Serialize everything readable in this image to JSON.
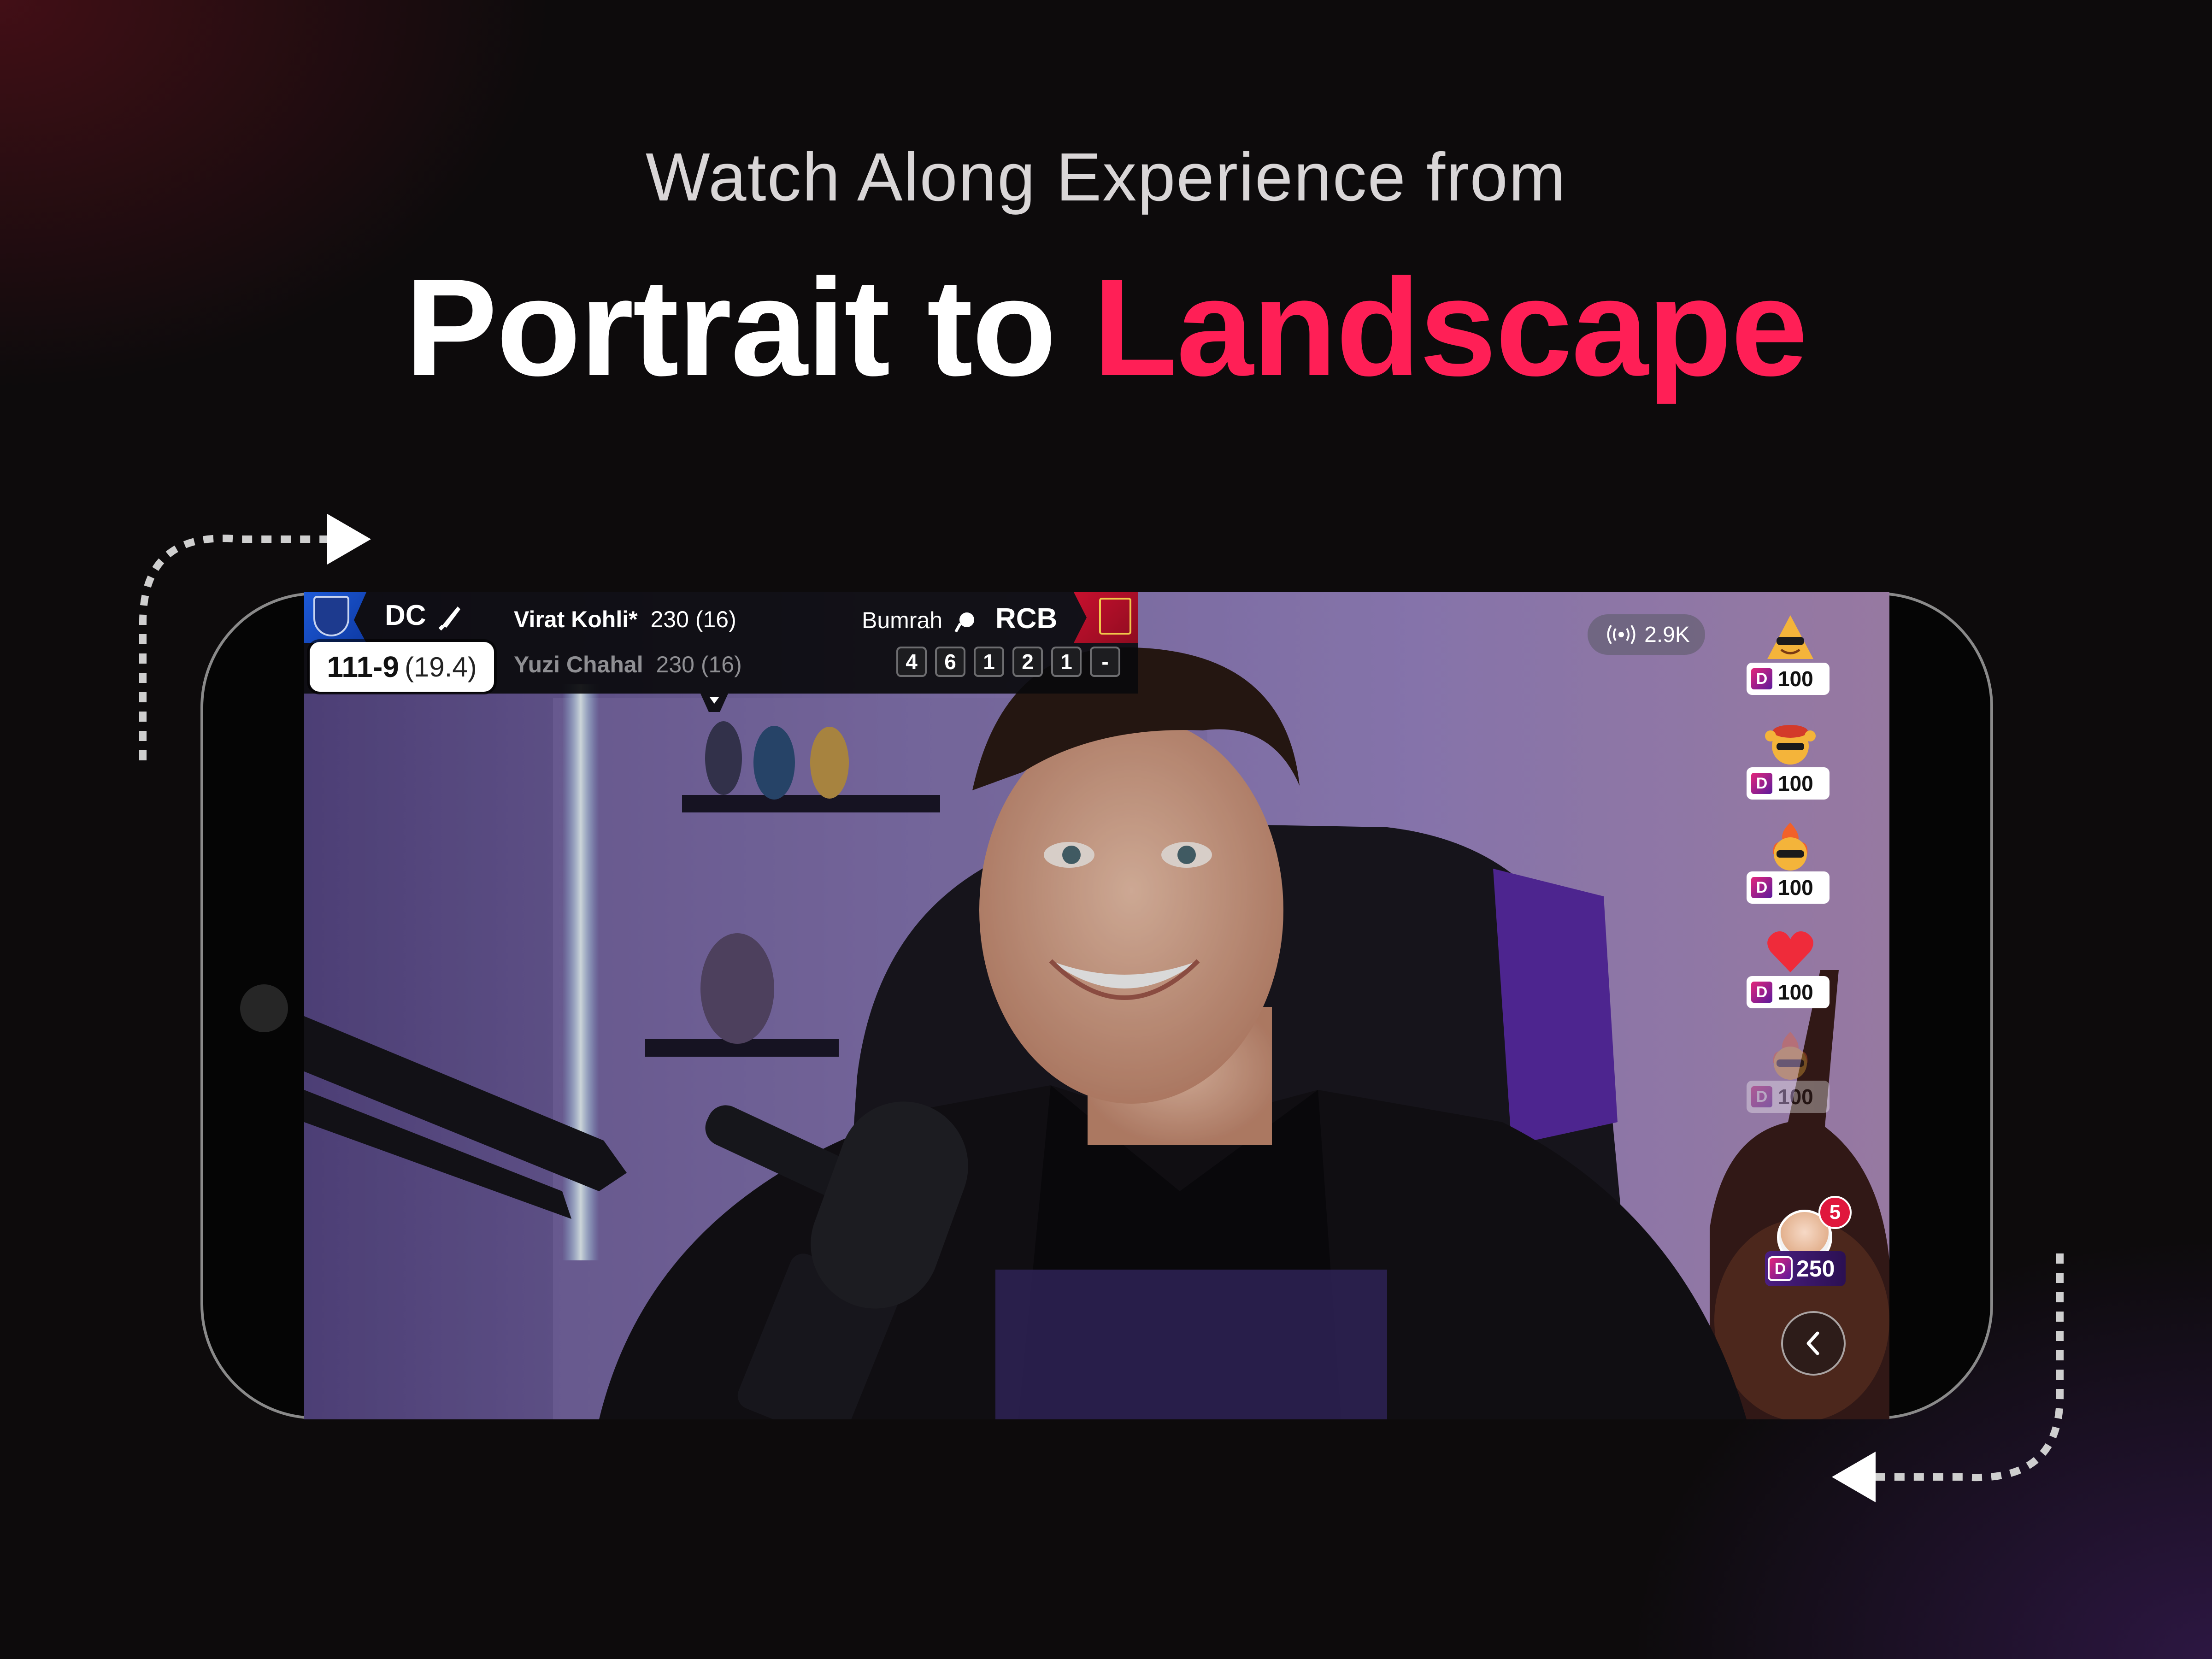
{
  "header": {
    "subtitle": "Watch Along Experience from",
    "title_main": "Portrait to",
    "title_accent": "Landscape"
  },
  "colors": {
    "accent": "#ff1f56",
    "background": "#0d0b0c",
    "dc_blue": "#1d5ad8",
    "rcb_red": "#c8102e"
  },
  "scorecard": {
    "batting_team": "DC",
    "batting_icon": "cricket-bat-icon",
    "score": "111-9",
    "overs": "(19.4)",
    "batsmen": [
      {
        "name": "Virat Kohli*",
        "stats": "230 (16)"
      },
      {
        "name": "Yuzi Chahal",
        "stats": "230 (16)"
      }
    ],
    "bowler": "Bumrah",
    "bowler_icon": "cricket-ball-icon",
    "bowling_team": "RCB",
    "balls": [
      "4",
      "6",
      "1",
      "2",
      "1",
      "-"
    ]
  },
  "viewers": {
    "icon": "live-broadcast-icon",
    "count": "2.9K"
  },
  "reactions": [
    {
      "emoji": "cool-triangle-emoji-icon",
      "amount": "100",
      "faded": false
    },
    {
      "emoji": "cheering-sunglasses-emoji-icon",
      "amount": "100",
      "faded": false
    },
    {
      "emoji": "fire-sunglasses-emoji-icon",
      "amount": "100",
      "faded": false
    },
    {
      "emoji": "red-heart-icon",
      "amount": "100",
      "faded": false
    },
    {
      "emoji": "fire-sunglasses-emoji-icon",
      "amount": "100",
      "faded": true
    }
  ],
  "coin_label": "D",
  "gift": {
    "badge_count": "5",
    "amount": "250"
  },
  "back_button_icon": "chevron-left-icon"
}
